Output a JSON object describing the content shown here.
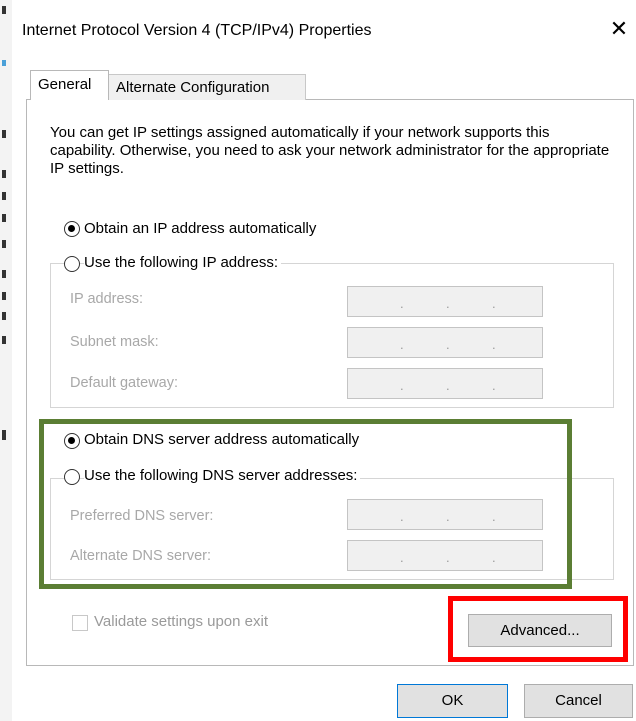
{
  "window": {
    "title": "Internet Protocol Version 4 (TCP/IPv4) Properties",
    "close_glyph": "✕"
  },
  "tabs": [
    {
      "label": "General",
      "active": true
    },
    {
      "label": "Alternate Configuration",
      "active": false
    }
  ],
  "intro_text": "You can get IP settings assigned automatically if your network supports this capability. Otherwise, you need to ask your network administrator for the appropriate IP settings.",
  "ip": {
    "auto_label": "Obtain an IP address automatically",
    "auto_selected": true,
    "manual_label": "Use the following IP address:",
    "fields": [
      {
        "label": "IP address:",
        "value": " .  .  . "
      },
      {
        "label": "Subnet mask:",
        "value": " .  .  . "
      },
      {
        "label": "Default gateway:",
        "value": " .  .  . "
      }
    ]
  },
  "dns": {
    "auto_label": "Obtain DNS server address automatically",
    "auto_selected": true,
    "manual_label": "Use the following DNS server addresses:",
    "fields": [
      {
        "label": "Preferred DNS server:",
        "value": " .  .  . "
      },
      {
        "label": "Alternate DNS server:",
        "value": " .  .  . "
      }
    ]
  },
  "validate_label": "Validate settings upon exit",
  "validate_checked": false,
  "buttons": {
    "advanced": "Advanced...",
    "ok": "OK",
    "cancel": "Cancel"
  },
  "colors": {
    "dns_highlight": "#5b7e34",
    "advanced_highlight": "#ff0000",
    "accent": "#0078d7"
  }
}
